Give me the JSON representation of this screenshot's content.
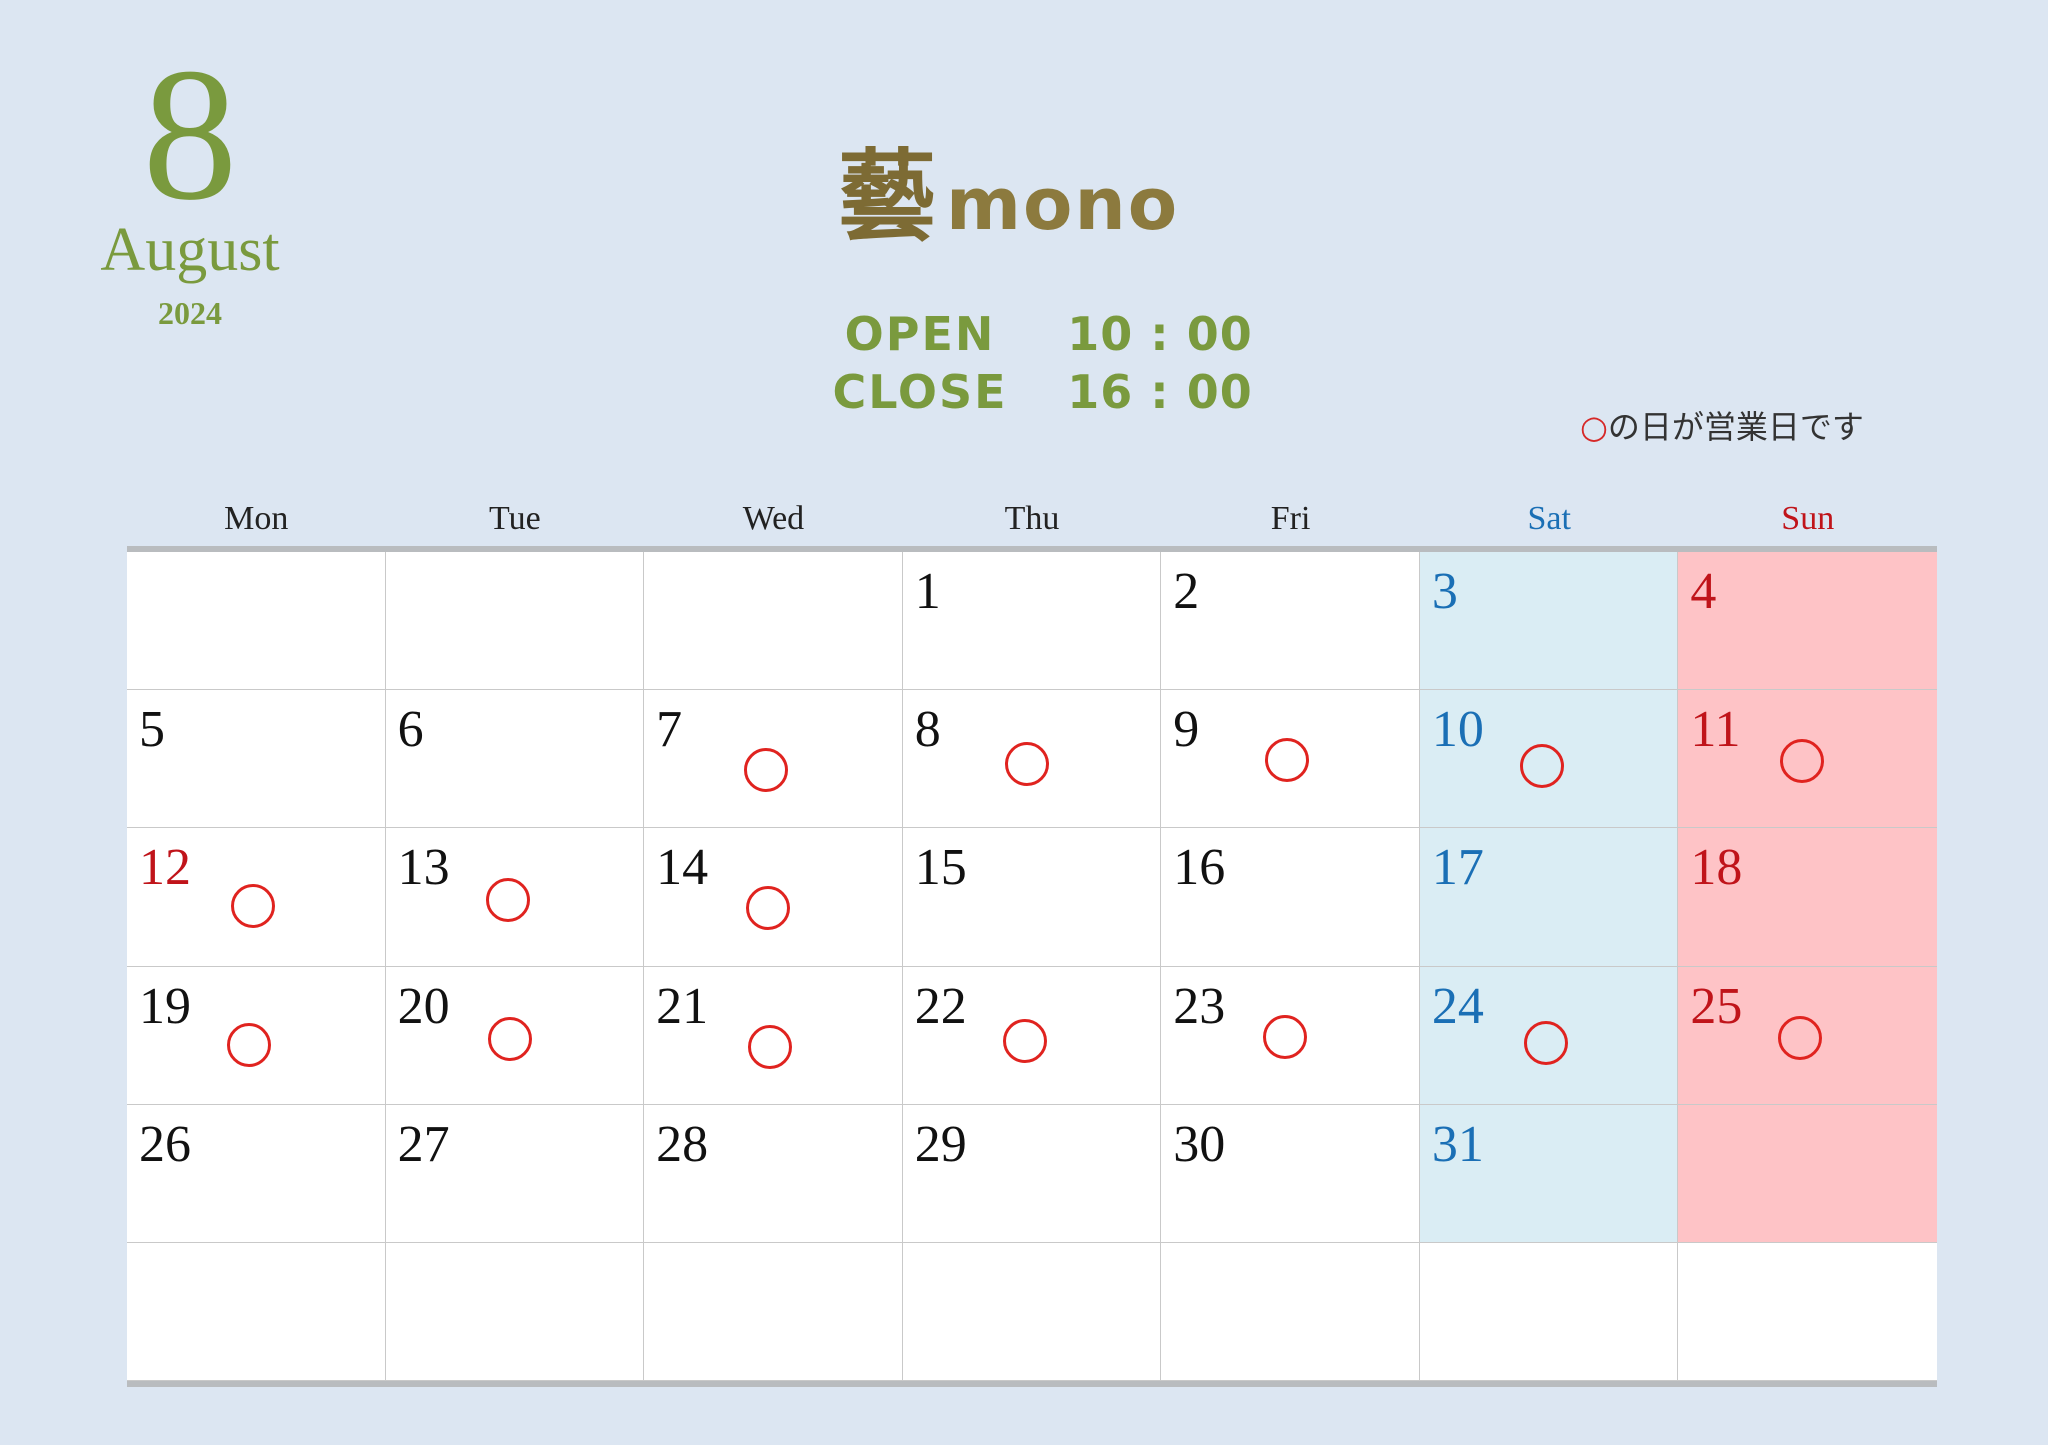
{
  "month": {
    "number": "8",
    "name": "August",
    "year": "2024"
  },
  "logo": {
    "kanji": "藝",
    "latin": "mono"
  },
  "hours": {
    "open_label": "OPEN",
    "open_time": "10 : 00",
    "close_label": "CLOSE",
    "close_time": "16 : 00"
  },
  "legend": {
    "symbol": "○",
    "text": "の日が営業日です"
  },
  "weekdays": [
    "Mon",
    "Tue",
    "Wed",
    "Thu",
    "Fri",
    "Sat",
    "Sun"
  ],
  "colors": {
    "accent_green": "#7a9a3e",
    "saturday": "#1a6fb5",
    "sunday": "#c0141a",
    "mark": "#e0231f",
    "sat_bg": "#daedf4",
    "sun_bg": "#fec3c6"
  },
  "calendar": {
    "weeks": [
      [
        {
          "day": ""
        },
        {
          "day": ""
        },
        {
          "day": ""
        },
        {
          "day": "1"
        },
        {
          "day": "2"
        },
        {
          "day": "3"
        },
        {
          "day": "4"
        }
      ],
      [
        {
          "day": "5"
        },
        {
          "day": "6"
        },
        {
          "day": "7",
          "open": true
        },
        {
          "day": "8",
          "open": true
        },
        {
          "day": "9",
          "open": true
        },
        {
          "day": "10",
          "open": true
        },
        {
          "day": "11",
          "open": true
        }
      ],
      [
        {
          "day": "12",
          "open": true,
          "holiday": true
        },
        {
          "day": "13",
          "open": true
        },
        {
          "day": "14",
          "open": true
        },
        {
          "day": "15"
        },
        {
          "day": "16"
        },
        {
          "day": "17"
        },
        {
          "day": "18"
        }
      ],
      [
        {
          "day": "19",
          "open": true
        },
        {
          "day": "20",
          "open": true
        },
        {
          "day": "21",
          "open": true
        },
        {
          "day": "22",
          "open": true
        },
        {
          "day": "23",
          "open": true
        },
        {
          "day": "24",
          "open": true
        },
        {
          "day": "25",
          "open": true
        }
      ],
      [
        {
          "day": "26"
        },
        {
          "day": "27"
        },
        {
          "day": "28"
        },
        {
          "day": "29"
        },
        {
          "day": "30"
        },
        {
          "day": "31"
        },
        {
          "day": ""
        }
      ],
      [
        {
          "day": ""
        },
        {
          "day": ""
        },
        {
          "day": ""
        },
        {
          "day": ""
        },
        {
          "day": ""
        },
        {
          "day": ""
        },
        {
          "day": ""
        }
      ]
    ]
  }
}
